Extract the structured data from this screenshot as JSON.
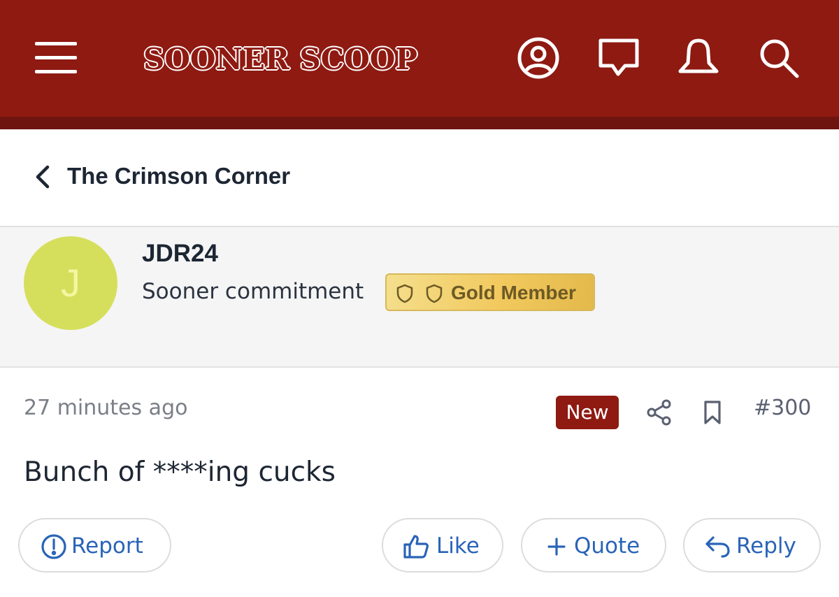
{
  "header": {
    "logo_text": "SOONER SCOOP",
    "icons": [
      "menu-icon",
      "account-icon",
      "conversations-icon",
      "alerts-icon",
      "search-icon"
    ],
    "colors": {
      "bar": "#8e1a12",
      "icon": "#ffffff"
    }
  },
  "breadcrumb": {
    "title": "The Crimson Corner"
  },
  "author": {
    "avatar_letter": "J",
    "avatar_color": "#d5df5c",
    "username": "JDR24",
    "user_title": "Sooner commitment",
    "badge_label": "Gold Member"
  },
  "post": {
    "time": "27 minutes ago",
    "new_tag": "New",
    "post_number": "#300",
    "content": "Bunch of ****ing cucks"
  },
  "actions": {
    "report": "Report",
    "like": "Like",
    "quote": "Quote",
    "reply": "Reply"
  },
  "colors": {
    "accent": "#2a64b8",
    "tag": "#8e1a12",
    "muted": "#7a7f87"
  }
}
